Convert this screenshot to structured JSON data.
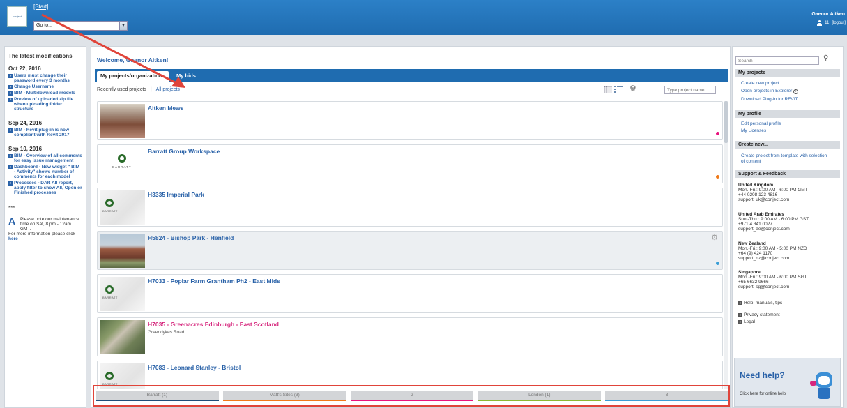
{
  "header": {
    "logo_text": "conject",
    "start_link": "[Start]",
    "goto_value": "Go to...",
    "user_name": "Gaenor Aitken",
    "user_count": "11",
    "logout": "[logout]"
  },
  "left": {
    "title": "The latest modifications",
    "groups": [
      {
        "date": "Oct 22, 2016",
        "items": [
          "Users must change their password every 3 months",
          "Change Username",
          "BIM - Multidownload models",
          "Preview of uploaded zip file when uploading folder structure"
        ]
      },
      {
        "date": "Sep 24, 2016",
        "items": [
          "BIM - Revit plug-in is now compliant with Revit 2017"
        ]
      },
      {
        "date": "Sep 10, 2016",
        "items": [
          "BIM - Overview of all comments for easy issue management",
          "Dashboard - New widget \" BIM - Activity\" shows number of comments for each model",
          "Processes - DAR All report, apply filter to show All, Open or Finished processes"
        ]
      }
    ],
    "separator": "***",
    "maintenance": "Please note our maintenance time on Sat, 8 pm - 12am GMT.",
    "maintenance_more": "For more information please click",
    "maintenance_link": "here"
  },
  "main": {
    "welcome": "Welcome, Gaenor Aitken!",
    "tab_projects": "My projects/organizations",
    "tab_bids": "My bids",
    "recent": "Recently used projects",
    "pipe": "|",
    "all_projects": "All projects",
    "filter_placeholder": "Type project name",
    "projects": [
      {
        "name": "Aitken Mews",
        "sub": "",
        "dot": "#e8147e"
      },
      {
        "name": "Barratt Group Workspace",
        "sub": "",
        "dot": "#f07a1a"
      },
      {
        "name": "H3335 Imperial Park",
        "sub": "",
        "dot": ""
      },
      {
        "name": "H5824 - Bishop Park - Henfield",
        "sub": "",
        "dot": "#3a9ed6"
      },
      {
        "name": "H7033 - Poplar Farm Grantham Ph2 - East Mids",
        "sub": "",
        "dot": ""
      },
      {
        "name": "H7035 - Greenacres Edinburgh - East Scotland",
        "sub": "Greendykes Road",
        "dot": ""
      },
      {
        "name": "H7083 - Leonard Stanley - Bristol",
        "sub": "",
        "dot": ""
      }
    ],
    "barratt_text": "BARRATT",
    "bottom_tabs": [
      {
        "label": "Barratt (1)",
        "color": "#1f4e79"
      },
      {
        "label": "Matt's Sites (3)",
        "color": "#f07a1a"
      },
      {
        "label": "2",
        "color": "#e8147e"
      },
      {
        "label": "London (1)",
        "color": "#8cb832"
      },
      {
        "label": "3",
        "color": "#3a9ed6"
      }
    ]
  },
  "right": {
    "search_placeholder": "Search",
    "my_projects": "My projects",
    "create_new_project": "Create new project",
    "open_explorer": "Open projects in Explorer",
    "download_plugin": "Download Plug-In for REVIT",
    "my_profile": "My profile",
    "edit_profile": "Edit personal profile",
    "my_licenses": "My Licenses",
    "create_new": "Create new...",
    "create_from_template": "Create project from template with selection of content",
    "support": "Support & Feedback",
    "contacts": [
      {
        "country": "United Kingdom",
        "hours": "Mon.-Fri.: 9:00 AM - 6:00 PM GMT",
        "phone": "+44 0208 123 4816",
        "email": "support_uk@conject.com"
      },
      {
        "country": "United Arab Emirates",
        "hours": "Sun.-Thu.: 9:00 AM - 6:00 PM GST",
        "phone": "+971 4 341 0027",
        "email": "support_ae@conject.com"
      },
      {
        "country": "New Zealand",
        "hours": "Mon.-Fri.: 9:00 AM - 5:00 PM NZD",
        "phone": "+64 (9) 424 1170",
        "email": "support_nz@conject.com"
      },
      {
        "country": "Singapore",
        "hours": "Mon.-Fri.: 9:00 AM - 6:00 PM SGT",
        "phone": "+65 6632 9666",
        "email": "support_sg@conject.com"
      }
    ],
    "help_manuals": "Help, manuals, tips",
    "privacy": "Privacy statement",
    "legal": "Legal",
    "need_help": "Need help?",
    "online_help": "Click here for online help"
  },
  "icons": {
    "gear": "gear-icon",
    "search": "search-icon",
    "user": "user-icon"
  }
}
